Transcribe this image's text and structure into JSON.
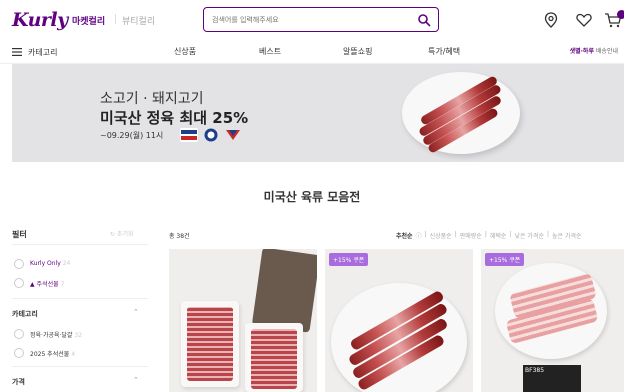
{
  "header": {
    "logo": "Kurly",
    "market_tab": "마켓컬리",
    "beauty_tab": "뷰티컬리",
    "search_placeholder": "검색어를 입력해주세요"
  },
  "nav": {
    "category": "카테고리",
    "items": [
      "신상품",
      "베스트",
      "알뜰쇼핑",
      "특가/혜택"
    ],
    "delivery_highlight": "샛별·하루",
    "delivery_rest": "배송안내"
  },
  "banner": {
    "subtitle": "소고기 · 돼지고기",
    "title": "미국산 정육 최대 25%",
    "date": "~09.29(월) 11시"
  },
  "section_title": "미국산 육류 모음전",
  "sidebar": {
    "filter_label": "필터",
    "reset_label": "초기화",
    "top_options": [
      {
        "label": "Kurly Only",
        "count": "24"
      },
      {
        "label": "주석선물",
        "count": "7"
      }
    ],
    "category_label": "카테고리",
    "category_options": [
      {
        "label": "정육·가공육·달걀",
        "count": "32"
      },
      {
        "label": "2025 추석선물",
        "count": "4"
      }
    ],
    "price_label": "가격"
  },
  "products": {
    "total": "총 38건",
    "sort_options": [
      "추천순",
      "신상품순",
      "판매량순",
      "혜택순",
      "낮은 가격순",
      "높은 가격순"
    ],
    "coupon": "+15% 쿠폰",
    "label_text": "BF385"
  },
  "colors": {
    "brand": "#5f0080",
    "coupon": "#a86cde"
  }
}
